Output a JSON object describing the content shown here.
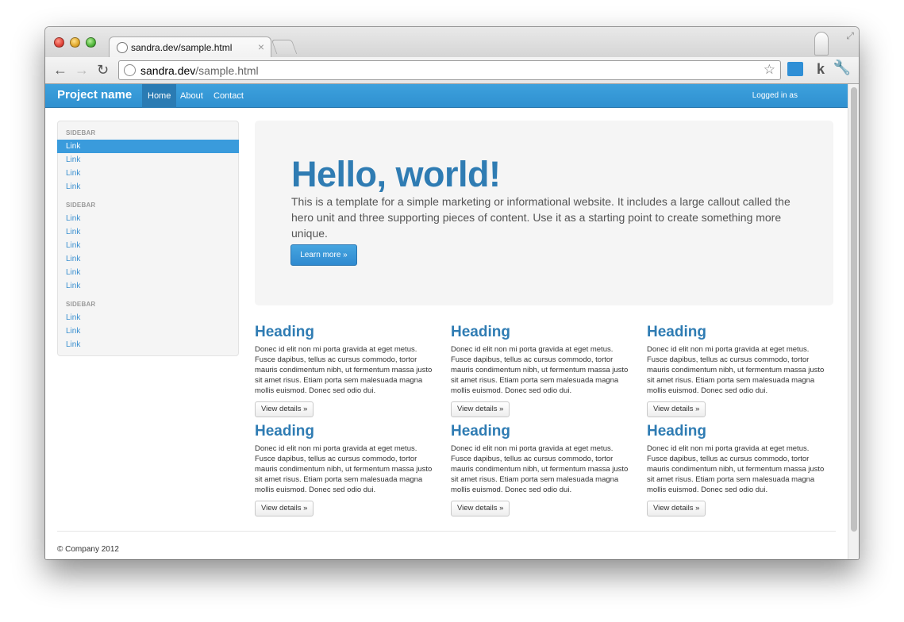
{
  "browser": {
    "tab_title": "sandra.dev/sample.html",
    "tab_close": "×",
    "url_host": "sandra.dev",
    "url_path": "/sample.html",
    "icons": [
      "back-icon",
      "forward-icon",
      "reload-icon",
      "globe-icon",
      "star-icon",
      "wrench-icon"
    ]
  },
  "navbar": {
    "brand": "Project name",
    "items": [
      {
        "label": "Home",
        "active": true
      },
      {
        "label": "About"
      },
      {
        "label": "Contact"
      }
    ],
    "logged_in": "Logged in as"
  },
  "sidebar": {
    "groups": [
      {
        "header": "SIDEBAR",
        "links": [
          "Link",
          "Link",
          "Link",
          "Link"
        ]
      },
      {
        "header": "SIDEBAR",
        "links": [
          "Link",
          "Link",
          "Link",
          "Link",
          "Link",
          "Link"
        ]
      },
      {
        "header": "SIDEBAR",
        "links": [
          "Link",
          "Link",
          "Link"
        ]
      }
    ]
  },
  "hero": {
    "title": "Hello, world!",
    "text": "This is a template for a simple marketing or informational website. It includes a large callout called the hero unit and three supporting pieces of content. Use it as a starting point to create something more unique.",
    "button": "Learn more »"
  },
  "cards": [
    {
      "heading": "Heading",
      "body": "Donec id elit non mi porta gravida at eget metus. Fusce dapibus, tellus ac cursus commodo, tortor mauris condimentum nibh, ut fermentum massa justo sit amet risus. Etiam porta sem malesuada magna mollis euismod. Donec sed odio dui.",
      "button": "View details »"
    },
    {
      "heading": "Heading",
      "body": "Donec id elit non mi porta gravida at eget metus. Fusce dapibus, tellus ac cursus commodo, tortor mauris condimentum nibh, ut fermentum massa justo sit amet risus. Etiam porta sem malesuada magna mollis euismod. Donec sed odio dui.",
      "button": "View details »"
    },
    {
      "heading": "Heading",
      "body": "Donec id elit non mi porta gravida at eget metus. Fusce dapibus, tellus ac cursus commodo, tortor mauris condimentum nibh, ut fermentum massa justo sit amet risus. Etiam porta sem malesuada magna mollis euismod. Donec sed odio dui.",
      "button": "View details »"
    },
    {
      "heading": "Heading",
      "body": "Donec id elit non mi porta gravida at eget metus. Fusce dapibus, tellus ac cursus commodo, tortor mauris condimentum nibh, ut fermentum massa justo sit amet risus. Etiam porta sem malesuada magna mollis euismod. Donec sed odio dui.",
      "button": "View details »"
    },
    {
      "heading": "Heading",
      "body": "Donec id elit non mi porta gravida at eget metus. Fusce dapibus, tellus ac cursus commodo, tortor mauris condimentum nibh, ut fermentum massa justo sit amet risus. Etiam porta sem malesuada magna mollis euismod. Donec sed odio dui.",
      "button": "View details »"
    },
    {
      "heading": "Heading",
      "body": "Donec id elit non mi porta gravida at eget metus. Fusce dapibus, tellus ac cursus commodo, tortor mauris condimentum nibh, ut fermentum massa justo sit amet risus. Etiam porta sem malesuada magna mollis euismod. Donec sed odio dui.",
      "button": "View details »"
    }
  ],
  "footer": {
    "text": "© Company 2012"
  },
  "colors": {
    "accent": "#3a9bdc",
    "heading": "#2f7cb3"
  }
}
